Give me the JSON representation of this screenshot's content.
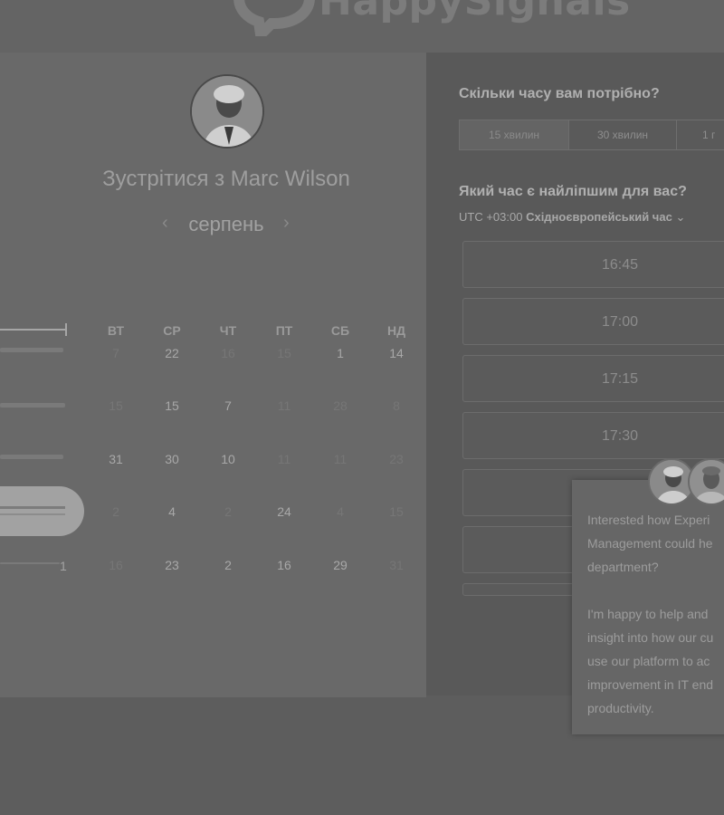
{
  "header": {
    "brand": "HappySignals"
  },
  "scheduler": {
    "meet_title": "Зустрітися з Marc Wilson",
    "month": "серпень",
    "prev_icon": "chevron-left-icon",
    "next_icon": "chevron-right-icon",
    "weekdays": [
      "ВТ",
      "СР",
      "ЧТ",
      "ПТ",
      "СБ",
      "НД"
    ],
    "weeks": [
      [
        {
          "d": "7",
          "on": false
        },
        {
          "d": "22",
          "on": true
        },
        {
          "d": "16",
          "on": false
        },
        {
          "d": "15",
          "on": false
        },
        {
          "d": "1",
          "on": true
        },
        {
          "d": "14",
          "on": true
        }
      ],
      [
        {
          "d": "15",
          "on": false
        },
        {
          "d": "15",
          "on": true
        },
        {
          "d": "7",
          "on": true
        },
        {
          "d": "11",
          "on": false
        },
        {
          "d": "28",
          "on": false
        },
        {
          "d": "8",
          "on": false
        }
      ],
      [
        {
          "d": "31",
          "on": true
        },
        {
          "d": "30",
          "on": true
        },
        {
          "d": "10",
          "on": true
        },
        {
          "d": "11",
          "on": false
        },
        {
          "d": "11",
          "on": false
        },
        {
          "d": "23",
          "on": false
        }
      ],
      [
        {
          "d": "2",
          "on": false
        },
        {
          "d": "4",
          "on": true
        },
        {
          "d": "2",
          "on": false
        },
        {
          "d": "24",
          "on": true
        },
        {
          "d": "4",
          "on": false
        },
        {
          "d": "15",
          "on": false
        }
      ],
      [
        {
          "d": "16",
          "on": false
        },
        {
          "d": "23",
          "on": true
        },
        {
          "d": "2",
          "on": true
        },
        {
          "d": "16",
          "on": true
        },
        {
          "d": "29",
          "on": true
        },
        {
          "d": "31",
          "on": false
        }
      ]
    ],
    "left_partial_one": "1"
  },
  "booking": {
    "duration_question": "Скільки часу вам потрібно?",
    "durations": [
      "15 хвилин",
      "30 хвилин",
      "1 г"
    ],
    "time_question": "Який час є найліпшим для вас?",
    "tz_offset": "UTC +03:00",
    "tz_name": "Східноєвропейський час",
    "slots": [
      "16:45",
      "17:00",
      "17:15",
      "17:30",
      "",
      "",
      ""
    ]
  },
  "chat_popup": {
    "lines": [
      "Interested how Experi",
      "Management could he",
      "department?",
      "",
      "I'm happy to help and",
      "insight into how our cu",
      "use our platform to ac",
      "improvement in IT end",
      "productivity."
    ]
  }
}
